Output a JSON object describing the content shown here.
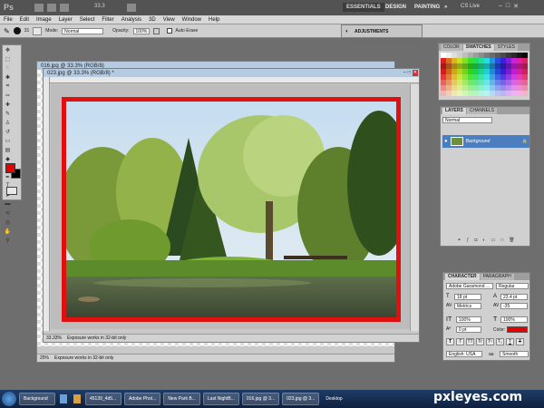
{
  "app": {
    "ps_label": "Ps",
    "zoom": "33.3",
    "mode_btn": "▾"
  },
  "workspace": {
    "essentials": "ESSENTIALS",
    "design": "DESIGN",
    "painting": "PAINTING",
    "more": "»",
    "cslive": "CS Live"
  },
  "menu": [
    "File",
    "Edit",
    "Image",
    "Layer",
    "Select",
    "Filter",
    "Analysis",
    "3D",
    "View",
    "Window",
    "Help"
  ],
  "options": {
    "brush_size": "31",
    "mode_label": "Mode:",
    "mode_value": "Normal",
    "opacity_label": "Opacity:",
    "opacity_value": "100%",
    "autoerase_label": "Auto Erase"
  },
  "adjustments_label": "ADJUSTMENTS",
  "doc_back": {
    "title": "016.jpg @ 33.3% (RGB/8)",
    "zoom": "25%",
    "status": "Exposure works in 32-bit only"
  },
  "doc_front": {
    "title": "023.jpg @ 33.3% (RGB/8) *",
    "zoom": "33.33%",
    "status": "Exposure works in 32-bit only"
  },
  "swatches_panel": {
    "tabs": [
      "COLOR",
      "SWATCHES",
      "STYLES"
    ],
    "active": "SWATCHES"
  },
  "layers_panel": {
    "tabs": [
      "LAYERS",
      "CHANNELS"
    ],
    "blend": "Normal",
    "layer_name": "Background"
  },
  "character_panel": {
    "tabs": [
      "CHARACTER",
      "PARAGRAPH"
    ],
    "font": "Adobe Garamond ...",
    "style": "Regular",
    "size": "18 pt",
    "leading": "23.4 pt",
    "kerning": "Metrics",
    "tracking": "-35",
    "vscale": "100%",
    "hscale": "100%",
    "baseline": "0 pt",
    "color_label": "Color:",
    "language": "English: USA",
    "aa_label": "aa",
    "aa": "Smooth"
  },
  "taskbar": [
    "Background",
    "45139_4d5...",
    "Adobe Phot...",
    "New Park B...",
    "Last NightB...",
    "016.jpg @ 3...",
    "023.jpg @ 3...",
    "Desktop"
  ],
  "watermark": "pxleyes.com",
  "colors": {
    "foreground": "#e60000",
    "background": "#000000",
    "frame": "#e01010",
    "accent": "#4a7ec0"
  }
}
